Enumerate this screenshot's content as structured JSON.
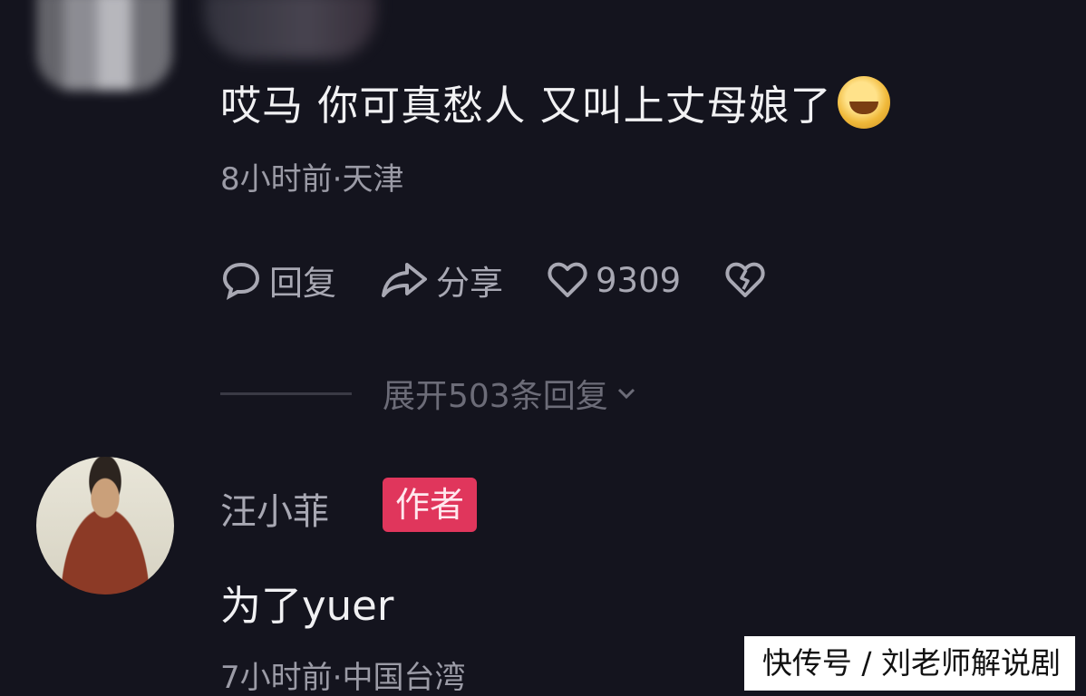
{
  "comment": {
    "text": "哎马 你可真愁人 又叫上丈母娘了",
    "emoji_icon": "laughing-face-icon",
    "meta": "8小时前·天津"
  },
  "actions": {
    "reply_label": "回复",
    "share_label": "分享",
    "like_count": "9309"
  },
  "replies": {
    "expand_label": "展开503条回复"
  },
  "author_reply": {
    "name": "汪小菲",
    "badge": "作者",
    "text": "为了yuer",
    "meta": "7小时前·中国台湾"
  },
  "watermark": "快传号 / 刘老师解说剧",
  "colors": {
    "background": "#14141e",
    "badge": "#e0365c"
  }
}
